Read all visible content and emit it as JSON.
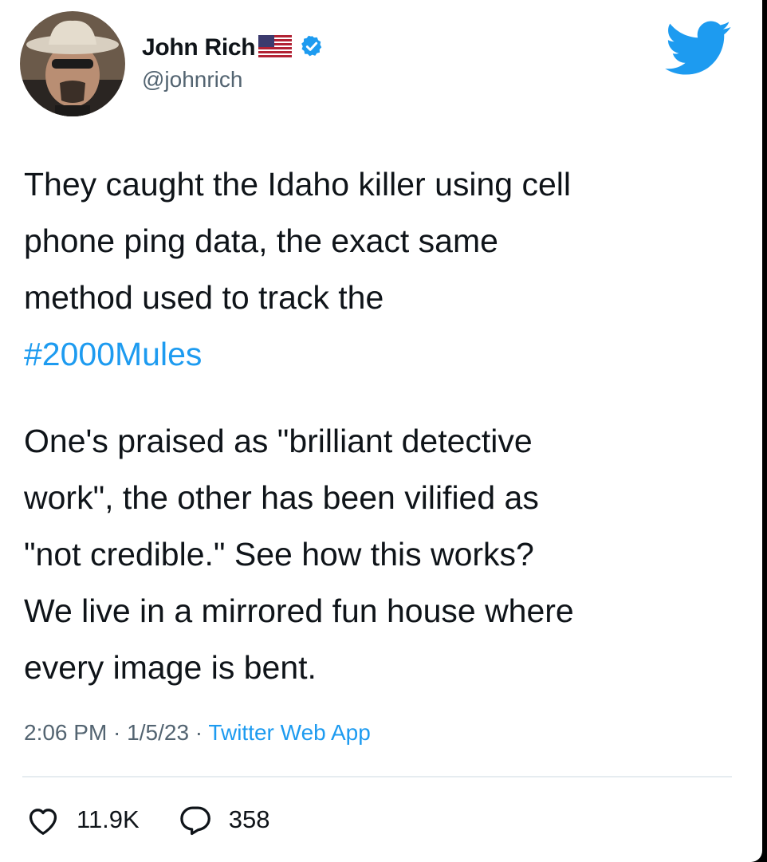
{
  "tweet": {
    "author": {
      "display_name": "John Rich",
      "handle": "@johnrich",
      "flag_icon": "us-flag-emoji",
      "verified_icon": "verified-badge-icon"
    },
    "body_paragraph_1_lines": [
      "They caught the Idaho killer using cell",
      "phone ping data, the exact same",
      "method used to track the"
    ],
    "hashtag": "#2000Mules",
    "body_paragraph_2_lines": [
      "One's praised as \"brilliant detective",
      "work\", the other has been vilified as",
      "\"not credible.\" See how this works?",
      "We live in a mirrored fun house where",
      "every image is bent."
    ],
    "time": "2:06 PM",
    "separator": " · ",
    "date": "1/5/23",
    "source": "Twitter Web App",
    "likes_count": "11.9K",
    "replies_count": "358"
  },
  "colors": {
    "link_blue": "#1d9bf0",
    "text": "#0f1419",
    "secondary_text": "#536471",
    "twitter_blue": "#1d9bf0"
  },
  "icons": {
    "brand": "twitter-bird-icon",
    "like": "heart-icon",
    "reply": "reply-bubble-icon"
  }
}
